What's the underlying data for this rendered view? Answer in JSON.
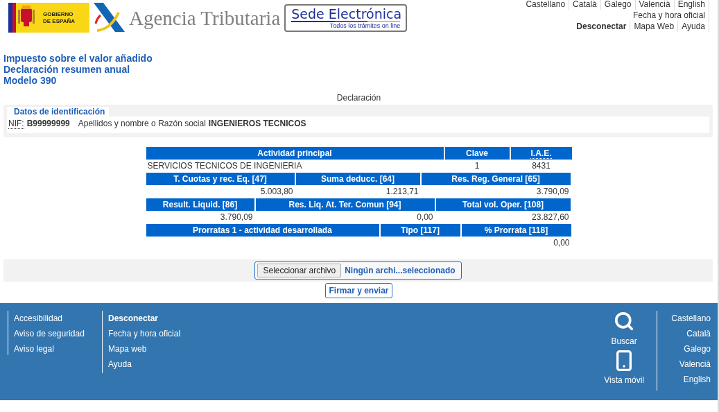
{
  "header": {
    "gov_logo": {
      "line1": "GOBIERNO",
      "line2": "DE ESPAÑA"
    },
    "agency_name": "Agencia Tributaria",
    "sede": {
      "title_part1": "Sede",
      "title_part2": "Electrónica",
      "subtitle": "Todos los trámites on line"
    },
    "languages": [
      "Castellano",
      "Català",
      "Galego",
      "Valencià",
      "English"
    ],
    "official_time": "Fecha y hora oficial",
    "links": [
      {
        "label": "Desconectar",
        "bold": true
      },
      {
        "label": "Mapa Web",
        "bold": false
      },
      {
        "label": "Ayuda",
        "bold": false
      }
    ]
  },
  "titles": [
    "Impuesto sobre el valor añadido",
    "Declaración resumen anual",
    "Modelo 390"
  ],
  "section_title": "Declaración",
  "identification": {
    "legend": "Datos de identificación",
    "nif_label": "NIF:",
    "nif": "B99999999",
    "name_label": "Apellidos y nombre o Razón social",
    "name": "INGENIEROS TECNICOS"
  },
  "sections": [
    {
      "headers": [
        {
          "label": "Actividad principal",
          "abbr": false
        },
        {
          "label": "Clave",
          "abbr": false
        },
        {
          "label": "I.A.E.",
          "abbr": true
        }
      ],
      "values": [
        "SERVICIOS TECNICOS DE INGENIERIA",
        "1",
        "8431"
      ],
      "kind": "activity"
    },
    {
      "headers": [
        {
          "label": "T. Cuotas y rec. Eq. [47]",
          "abbr": false
        },
        {
          "label": "Suma deducc. [64]",
          "abbr": false
        },
        {
          "label": "Res. Reg. General [65]",
          "abbr": false
        }
      ],
      "values": [
        "5.003,80",
        "1.213,71",
        "3.790,09"
      ],
      "kind": "amounts"
    },
    {
      "headers": [
        {
          "label": "Result. Liquid. [86]",
          "abbr": false
        },
        {
          "label": "Res. Liq. At. Ter. Comun [94]",
          "abbr": false
        },
        {
          "label": "Total vol. Oper. [108]",
          "abbr": false
        }
      ],
      "values": [
        "3.790,09",
        "0,00",
        "23.827,60"
      ],
      "kind": "amounts"
    },
    {
      "headers": [
        {
          "label": "Prorratas 1 - actividad desarrollada",
          "abbr": false
        },
        {
          "label": "Tipo [117]",
          "abbr": false
        },
        {
          "label": "% Prorrata [118]",
          "abbr": false
        }
      ],
      "values": [
        "0,00"
      ],
      "kind": "amounts"
    }
  ],
  "file_input": {
    "button": "Seleccionar archivo",
    "status": "Ningún archi...seleccionado"
  },
  "submit_button": "Firmar y enviar",
  "footer": {
    "column_1": [
      {
        "label": "Accesibilidad",
        "bold": false
      },
      {
        "label": "Aviso de seguridad",
        "bold": false
      },
      {
        "label": "Aviso legal",
        "bold": false
      }
    ],
    "column_2": [
      {
        "label": "Desconectar",
        "bold": true
      },
      {
        "label": "Fecha y hora oficial",
        "bold": false
      },
      {
        "label": "Mapa web",
        "bold": false
      },
      {
        "label": "Ayuda",
        "bold": false
      }
    ],
    "search": "Buscar",
    "mobile": "Vista móvil",
    "languages": [
      "Castellano",
      "Català",
      "Galego",
      "Valencià",
      "English"
    ]
  }
}
